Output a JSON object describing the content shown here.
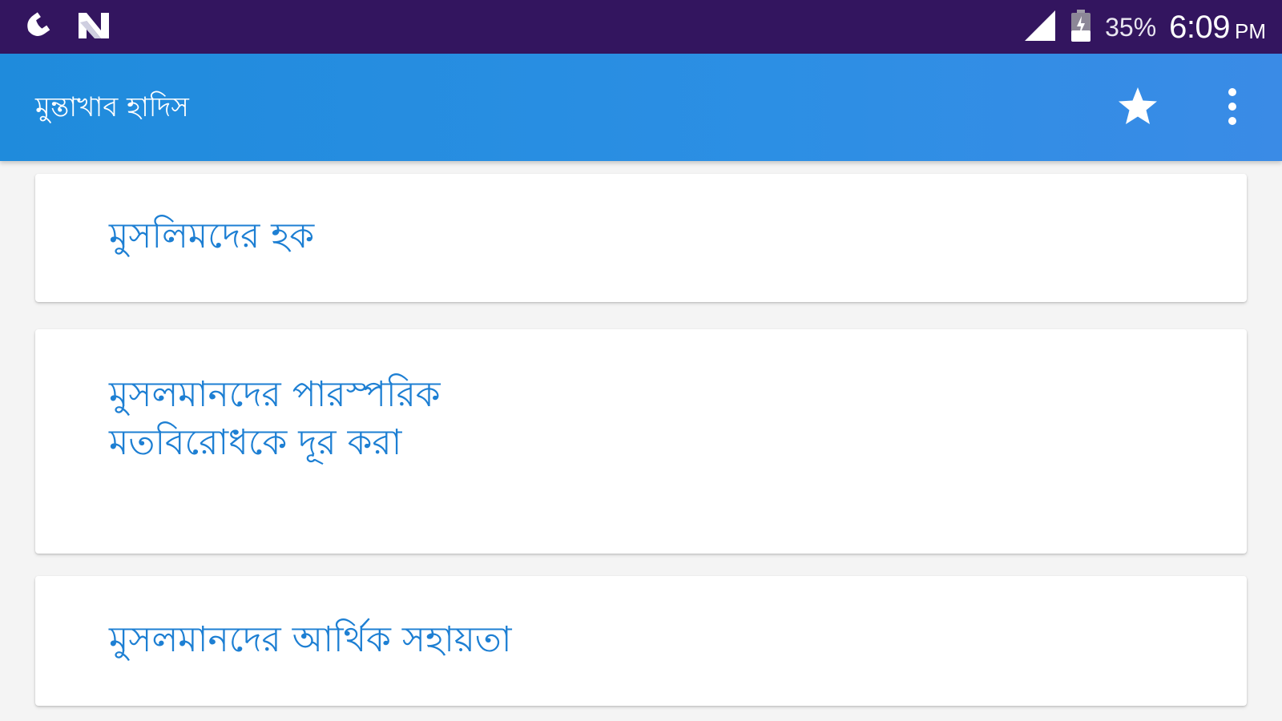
{
  "status_bar": {
    "left_icons": [
      "phone-call-icon",
      "n-notification-icon"
    ],
    "signal_icon": "cell-signal-icon",
    "battery_icon": "battery-icon",
    "battery_percent": "35%",
    "time": "6:09",
    "ampm": "PM",
    "background": "#33155f"
  },
  "app_bar": {
    "title": "মুন্তাখাব হাদিস",
    "favorite_icon": "star-icon",
    "more_icon": "more-vertical-icon",
    "color": "#2c8fe4"
  },
  "list": {
    "items": [
      {
        "label": "মুসলিমদের হক"
      },
      {
        "label": "মুসলমানদের পারস্পরিক\nমতবিরোধকে দূর করা"
      },
      {
        "label": "মুসলমানদের আর্থিক সহায়তা"
      }
    ],
    "text_color": "#1d7fd3"
  }
}
